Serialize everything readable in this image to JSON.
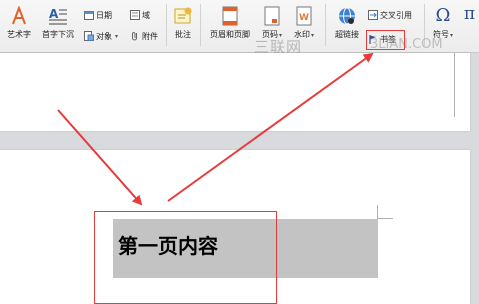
{
  "ribbon": {
    "art_text": "艺术字",
    "drop_cap": "首字下沉",
    "date": "日期",
    "field": "域",
    "object": "对象",
    "attachment": "附件",
    "comment": "批注",
    "header_footer": "页眉和页脚",
    "page_number": "页码",
    "watermark": "水印",
    "hyperlink": "超链接",
    "cross_reference": "交叉引用",
    "bookmark": "书签",
    "symbol": "符号",
    "equation_symbol": "π"
  },
  "overlay": {
    "watermark_text": "三联网",
    "watermark_site": "3LIAN.COM"
  },
  "document": {
    "page1_text": "第一页内容"
  },
  "colors": {
    "annotation_red": "#e53b3b",
    "selection_gray": "#c3c3c3"
  }
}
